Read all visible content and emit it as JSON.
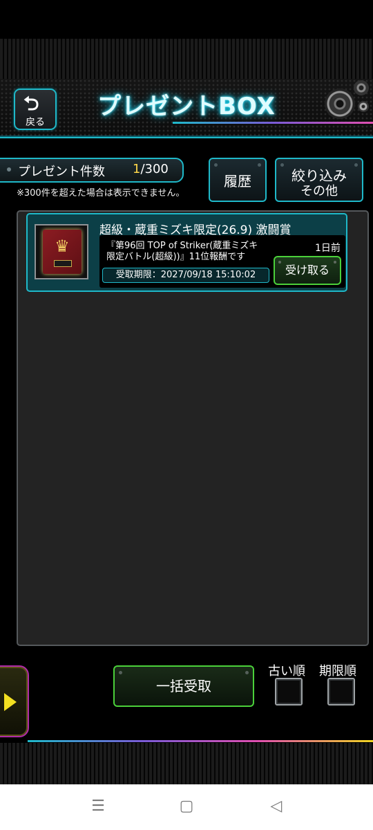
{
  "header": {
    "back_label": "戻る",
    "title": "プレゼントBOX"
  },
  "summary": {
    "label": "プレゼント件数",
    "current": "1",
    "max": "/300",
    "note": "※300件を超えた場合は表示できません。"
  },
  "buttons": {
    "history": "履歴",
    "filter_line1": "絞り込み",
    "filter_line2": "その他"
  },
  "items": [
    {
      "title": "超級・蔵重ミズキ限定(26.9) 激闘賞",
      "desc_line1": "『第96回 TOP of Striker(蔵重ミズキ",
      "desc_line2": "限定バトル(超級))』11位報酬です",
      "age": "1日前",
      "deadline": "受取期限：2027/09/18 15:10:02",
      "receive_label": "受け取る"
    }
  ],
  "footer": {
    "bulk_receive": "一括受取",
    "sort_old": "古い順",
    "sort_deadline": "期限順"
  },
  "navbar": {
    "menu_glyph": "☰",
    "home_glyph": "▢",
    "back_glyph": "◁"
  },
  "colors": {
    "accent_cyan": "#1fb9c9",
    "accent_green": "#4bd13a",
    "count_highlight": "#ffd84a",
    "card_bg": "#0c3f47"
  }
}
